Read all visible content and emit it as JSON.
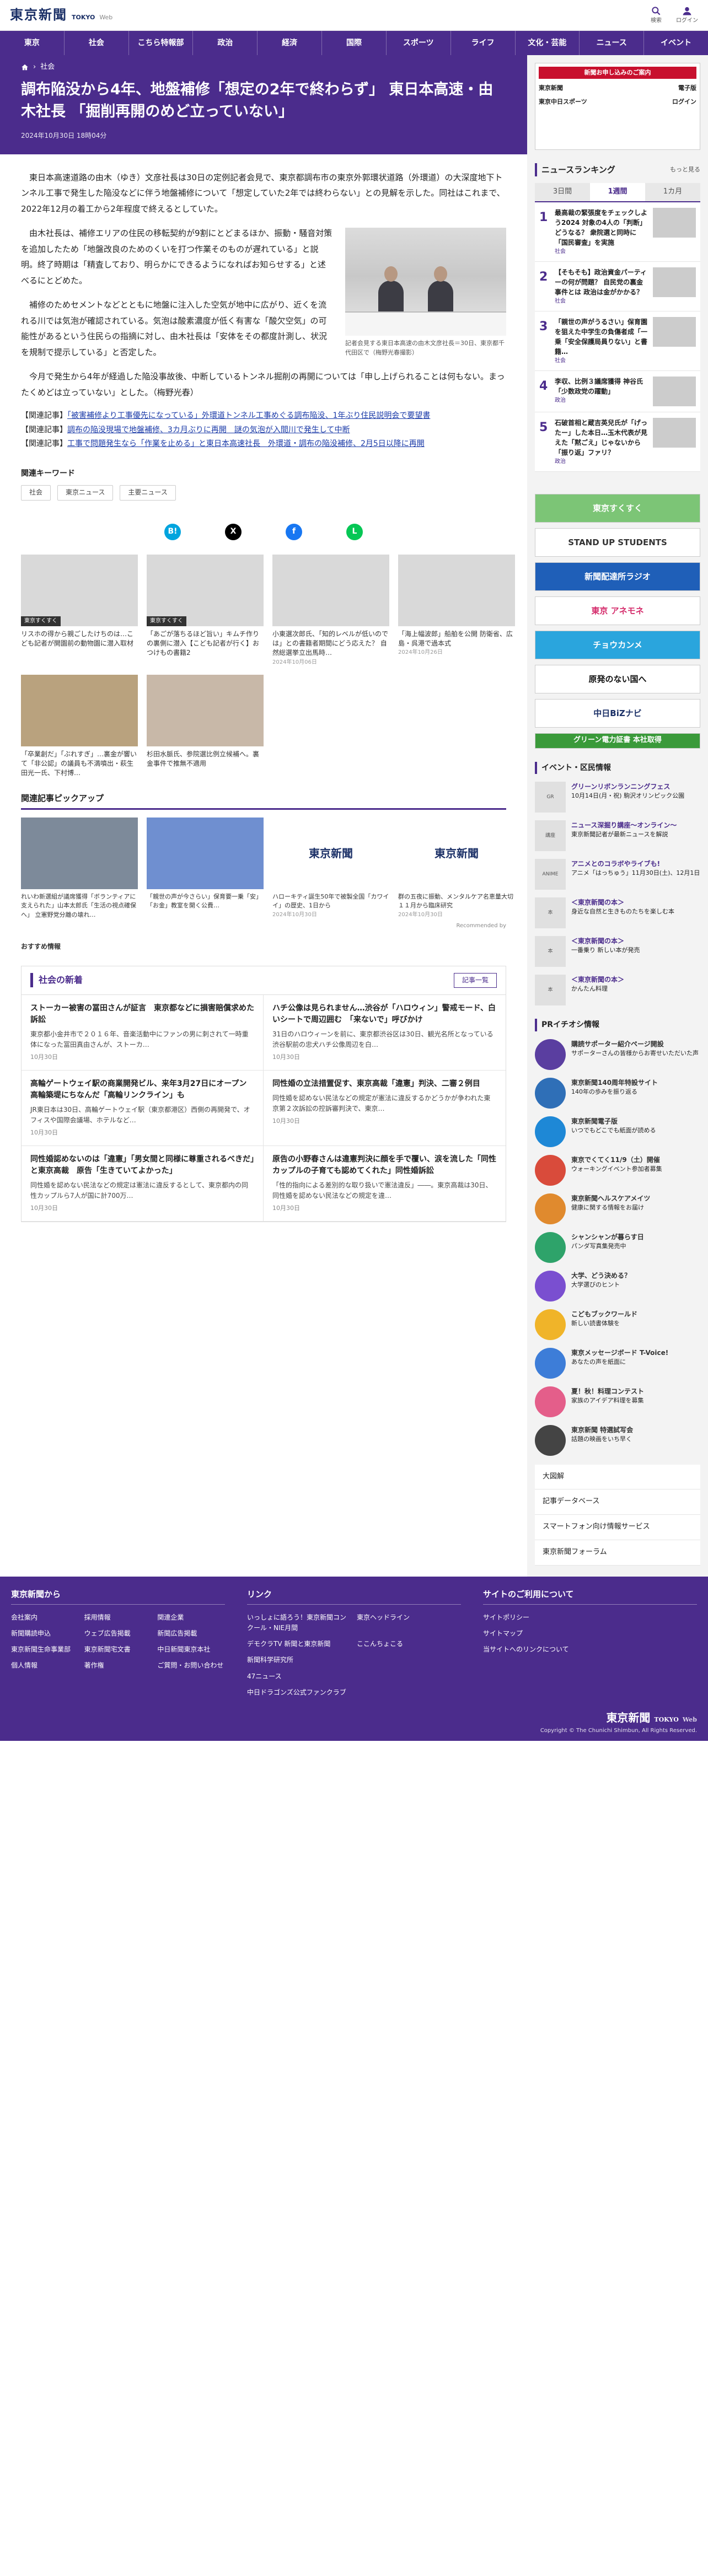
{
  "header": {
    "logo": "東京新聞",
    "logo_sub": "TOKYO",
    "logo_sub2": "Web",
    "search_label": "検索",
    "login_label": "ログイン"
  },
  "nav": [
    "東京",
    "社会",
    "こちら特報部",
    "政治",
    "経済",
    "国際",
    "スポーツ",
    "ライフ",
    "文化・芸能",
    "ニュース",
    "イベント"
  ],
  "breadcrumb": {
    "category": "社会"
  },
  "article": {
    "title": "調布陥没から4年、地盤補修「想定の2年で終わらず」 東日本高速・由木社長 「掘削再開のめど立っていない」",
    "date": "2024年10月30日 18時04分",
    "p1": "東日本高速道路の由木（ゆき）文彦社長は30日の定例記者会見で、東京都調布市の東京外郭環状道路（外環道）の大深度地下トンネル工事で発生した陥没などに伴う地盤補修について「想定していた2年では終わらない」との見解を示した。同社はこれまで、2022年12月の着工から2年程度で終えるとしていた。",
    "p2": "由木社長は、補修エリアの住民の移転契約が9割にとどまるほか、振動・騒音対策を追加したため「地盤改良のためのくいを打つ作業そのものが遅れている」と説明。終了時期は「精査しており、明らかにできるようになればお知らせする」と述べるにとどめた。",
    "p3": "補修のためセメントなどとともに地盤に注入した空気が地中に広がり、近くを流れる川では気泡が確認されている。気泡は酸素濃度が低く有害な「酸欠空気」の可能性があるという住民らの指摘に対し、由木社長は「安体をその都度計測し、状況を規制で提示している」と否定した。",
    "p4": "今月で発生から4年が経過した陥没事故後、中断しているトンネル掘削の再開については「申し上げられることは何もない。まったくめどは立っていない」とした。（梅野光春）",
    "caption": "記者会見する東日本高速の由木文彦社長＝30日、東京都千代田区で（梅野光春撮影）",
    "related": [
      {
        "prefix": "【関連記事】",
        "text": "「被害補修より工事優先になっている」外環道トンネル工事めぐる調布陥没、1年ぶり住民説明会で要望書"
      },
      {
        "prefix": "【関連記事】",
        "text": "調布の陥没現場で地盤補修、3カ月ぶりに再開　謎の気泡が入間川で発生して中断"
      },
      {
        "prefix": "【関連記事】",
        "text": "工事で問題発生なら「作業を止める」と東日本高速社長　外環道・調布の陥没補修、2月5日以降に再開"
      }
    ]
  },
  "keywords": {
    "title": "関連キーワード",
    "tags": [
      "社会",
      "東京ニュース",
      "主要ニュース"
    ]
  },
  "share": {
    "hatena": "B!",
    "x": "X",
    "facebook": "f",
    "line": "L"
  },
  "related_thumbs": [
    {
      "tag": "東京すくすく",
      "title": "リスホの得から親ごしたけちのは…こども記者が開園前の動物園に潜入取材",
      "date": ""
    },
    {
      "tag": "東京すくすく",
      "title": "「あごが落ちるほど旨い」キムチ作りの裏側に潜入【こども記者が行く】おつけもの書籍2",
      "date": ""
    },
    {
      "tag": "",
      "title": "小東選次郎氏、「知的レベルが低いのでは」との書籍者期間にどう応えた？ 自然総選挙立出馬時…",
      "date": "2024年10月06日"
    },
    {
      "tag": "",
      "title": "「海上幅波郎」船舶を公開 防衛省、広島・呉港で過本式",
      "date": "2024年10月26日"
    },
    {
      "tag": "",
      "title": "「卒業創だ」「ぶれすぎ」…裏金が響いて「非公認」の議員も不満噴出・萩生田光一氏、下村博…",
      "date": "2024年10月07日"
    },
    {
      "tag": "",
      "title": "杉田水脈氏、参院選比例立候補へ。裏金事件で推無不適用",
      "date": "2024年10月12日"
    }
  ],
  "pickup": {
    "title": "関連記事ピックアップ",
    "items": [
      {
        "title": "れいわ新選組が議席獲得「ボランティアに支えられた」山本太郎氏「生活の視点確保へ」 立憲野党分離の壊れ…",
        "logo": "",
        "date": ""
      },
      {
        "title": "「親世の声が今さらい」保育要一乗「安」「お金」教室を開く公費…",
        "logo": "",
        "date": ""
      },
      {
        "title": "ハローキティ誕生50年で被製全国「カワイイ」の歴史、1日から",
        "logo": "東京新聞",
        "date": "2024年10月30日"
      },
      {
        "title": "群の五夜に振動、メンタルケア名恵量大切１１月から臨床研究",
        "logo": "東京新聞",
        "date": "2024年10月30日"
      }
    ],
    "recommended_by": "Recommended by"
  },
  "osusume": "おすすめ情報",
  "shinbun": {
    "title": "社会の新着",
    "more": "記事一覧",
    "items": [
      {
        "title": "ストーカー被害の冨田さんが証言　東京都などに損害賠償求めた訴訟",
        "desc": "東京都小金井市で２０１６年、音楽活動中にファンの男に刺されて一時重体になった冨田真由さんが、ストーカ…",
        "date": "10月30日"
      },
      {
        "title": "ハチ公像は見られません…渋谷が「ハロウィン」警戒モード、白いシートで周辺囲む　「来ないで」呼びかけ",
        "desc": "31日のハロウィーンを前に、東京都渋谷区は30日、観光名所となっている渋谷駅前の忠犬ハチ公像周辺を白…",
        "date": "10月30日"
      },
      {
        "title": "高輪ゲートウェイ駅の商業開発ビル、来年3月27日にオープン　高輪築堤にちなんだ「高輪リンクライン」も",
        "desc": "JR東日本は30日、高輪ゲートウェイ駅（東京都港区）西側の再開発で、オフィスや国際会議場、ホテルなど…",
        "date": "10月30日"
      },
      {
        "title": "同性婚の立法措置促す、東京高裁「違憲」判決、二審２例目",
        "desc": "同性婚を認めない民法などの規定が憲法に違反するかどうかが争われた東京第２次訴訟の控訴審判決で、東京…",
        "date": "10月30日"
      },
      {
        "title": "同性婚認めないのは「違憲」「男女間と同様に尊重されるべきだ」と東京高裁　原告「生きていてよかった」",
        "desc": "同性婚を認めない民法などの規定は憲法に違反するとして、東京都内の同性カップルら7人が国に計700万…",
        "date": "10月30日"
      },
      {
        "title": "原告の小野春さんは違憲判決に顔を手で覆い、涙を流した「同性カップルの子育ても認めてくれた」同性婚訴訟",
        "desc": "「性的指向による差別的な取り扱いで憲法違反」――。東京高裁は30日、同性婚を認めない民法などの規定を違…",
        "date": "10月30日"
      }
    ]
  },
  "sidebar": {
    "ad": {
      "head": "新聞お申し込みのご案内",
      "row1a": "東京新聞",
      "row1b": "電子版",
      "row2a": "東京中日スポーツ",
      "row2b": "ログイン"
    },
    "ranking": {
      "title": "ニュースランキング",
      "more": "もっと見る",
      "tabs": [
        "3日間",
        "1週間",
        "1カ月"
      ],
      "items": [
        {
          "no": "1",
          "title": "最高裁の緊張度をチェックしよう2024 対象の4人の「判断」どうなる？ 衆院選と同時に「国民審査」を実施",
          "cat": "社会"
        },
        {
          "no": "2",
          "title": "【そもそも】政治資金パーティーの何が問題？ 自民党の裏金事件とは 政治は金がかかる？",
          "cat": "社会"
        },
        {
          "no": "3",
          "title": "「親世の声がうるさい」保育園を狙えた中学生の負傷者成「一乗「安全保護局員りない」と書籍…",
          "cat": "社会"
        },
        {
          "no": "4",
          "title": "李収、比例３議席獲得 神谷氏「少数政党の躍動」",
          "cat": "政治"
        },
        {
          "no": "5",
          "title": "石破首相と蔵吉英兒氏が「げったー」した本日…玉木代表が見えた「黙ごえ」じゃないから「振り返」ファリ？",
          "cat": "政治"
        }
      ]
    },
    "banners": [
      "東京すくすく",
      "STAND UP STUDENTS",
      "新聞配達所ラジオ",
      "東京 アネモネ",
      "チョウカンメ",
      "原発のない国へ",
      "中日BiZナビ",
      "グリーン電力証書 本社取得"
    ],
    "events_title": "イベント・区民情報",
    "events": [
      {
        "name": "グリーンリボンランニングフェス",
        "desc": "10月14日(月・祝) 駒沢オリンピック公園",
        "label": "GR"
      },
      {
        "name": "ニュース深掘り講座～オンライン～",
        "desc": "東京新聞記者が最新ニュースを解説",
        "label": "講座"
      },
      {
        "name": "アニメとのコラボやライブも!",
        "desc": "アニメ「はっちゅう」11月30日(土)、12月1日",
        "label": "ANIME"
      },
      {
        "name": "＜東京新聞の本＞",
        "desc": "身近な自然と生きものたちを楽しむ本",
        "label": "本"
      },
      {
        "name": "＜東京新聞の本＞",
        "desc": "一番乗り 新しい本が発売",
        "label": "本"
      },
      {
        "name": "＜東京新聞の本＞",
        "desc": "かんたん料理",
        "label": "本"
      }
    ],
    "pr_title": "PRイチオシ情報",
    "pr": [
      {
        "name": "購読サポーター紹介ページ開設",
        "desc": "サポーターさんの皆様からお寄せいただいた声",
        "color": "#5a3ea0"
      },
      {
        "name": "東京新聞140周年特設サイト",
        "desc": "140年の歩みを振り返る",
        "color": "#2f6fb7"
      },
      {
        "name": "東京新聞電子版",
        "desc": "いつでもどこでも紙面が読める",
        "color": "#1e88d6"
      },
      {
        "name": "東京でくてく11/9（土）開催",
        "desc": "ウォーキングイベント参加者募集",
        "color": "#d94b3b"
      },
      {
        "name": "東京新聞ヘルスケアメイツ",
        "desc": "健康に関する情報をお届け",
        "color": "#e08a2e"
      },
      {
        "name": "シャンシャンが暮らす日",
        "desc": "パンダ写真集発売中",
        "color": "#2ea36a"
      },
      {
        "name": "大学、どう決める？",
        "desc": "大学選びのヒント",
        "color": "#7a4fd0"
      },
      {
        "name": "こどもブックワールド",
        "desc": "新しい読書体験を",
        "color": "#f0b429"
      },
      {
        "name": "東京メッセージボード T-Voice!",
        "desc": "あなたの声を紙面に",
        "color": "#3d7dd8"
      },
      {
        "name": "夏！秋！料理コンテスト",
        "desc": "家族のアイデア料理を募集",
        "color": "#e45e8a"
      },
      {
        "name": "東京新聞 特選試写会",
        "desc": "話題の映画をいち早く",
        "color": "#444444"
      }
    ],
    "links": [
      "大図解",
      "記事データベース",
      "スマートフォン向け情報サービス",
      "東京新聞フォーラム"
    ]
  },
  "footer": {
    "col1_title": "東京新聞から",
    "col1_links": [
      "会社案内",
      "採用情報",
      "関連企業",
      "新聞購読申込",
      "ウェブ広告掲載",
      "新聞広告掲載",
      "東京新聞生命事業部",
      "東京新聞宅文書",
      "中日新聞東京本社",
      "個人情報",
      "著作権",
      "ご質問・お問い合わせ"
    ],
    "col2_title": "リンク",
    "col2_links": [
      "いっしょに語ろう！東京新聞コンクール・NIE月間",
      "東京ヘッドライン",
      "デモクラTV 新聞と東京新聞",
      "ここんちょこる",
      "新聞科学研究所",
      "",
      "47ニュース",
      "",
      "中日ドラゴンズ公式ファンクラブ",
      ""
    ],
    "col3_title": "サイトのご利用について",
    "col3_links": [
      "サイトポリシー",
      "サイトマップ",
      "当サイトへのリンクについて"
    ],
    "copyright": "Copyright © The Chunichi Shimbun, All Rights Reserved."
  }
}
